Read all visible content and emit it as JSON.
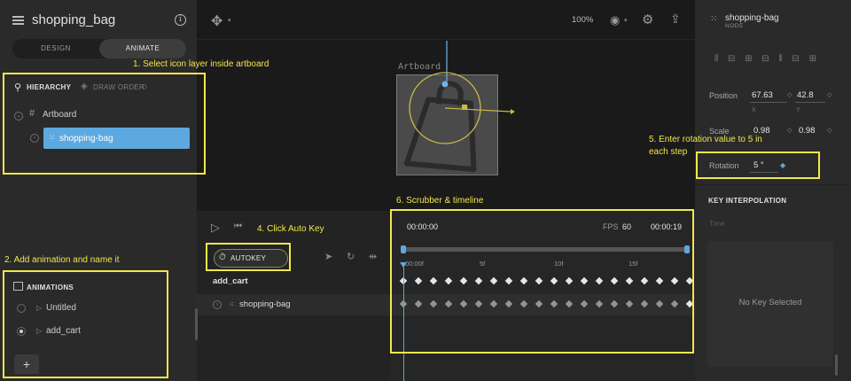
{
  "header": {
    "file_title": "shopping_bag",
    "mode_design": "DESIGN",
    "mode_animate": "ANIMATE",
    "zoom": "100%"
  },
  "hierarchy": {
    "tab_hierarchy": "HIERARCHY",
    "tab_draw_order": "DRAW ORDER",
    "artboard": "Artboard",
    "selected_node": "shopping-bag"
  },
  "animations": {
    "title": "ANIMATIONS",
    "items": [
      {
        "name": "Untitled",
        "selected": false
      },
      {
        "name": "add_cart",
        "selected": true
      }
    ],
    "add_label": "+"
  },
  "stage": {
    "artboard_label": "Artboard"
  },
  "inspector": {
    "node_name": "shopping-bag",
    "node_type": "NODE",
    "position_label": "Position",
    "position_x": "67.63",
    "position_y": "42.8",
    "x_sub": "X",
    "y_sub": "Y",
    "scale_label": "Scale",
    "scale_x": "0.98",
    "scale_y": "0.98",
    "rotation_label": "Rotation",
    "rotation_value": "5 °",
    "key_interp_title": "KEY INTERPOLATION",
    "time_label": "Time",
    "no_key": "No Key Selected"
  },
  "timeline": {
    "autokey": "AUTOKEY",
    "animation_name": "add_cart",
    "track_name": "shopping-bag",
    "current_time": "00:00:00",
    "fps_label": "FPS",
    "fps_value": "60",
    "end_time": "00:00:19",
    "frame_labels": [
      "00:00f",
      "5f",
      "10f",
      "15f"
    ]
  },
  "annotations": {
    "step1": "1. Select icon layer inside artboard",
    "step2": "2. Add animation and name it",
    "step4": "4. Click Auto Key",
    "step5_line1": "5. Enter rotation value to 5 in",
    "step5_line2": "each step",
    "step6": "6. Scrubber & timeline"
  },
  "colors": {
    "accent": "#5ea8e0",
    "annotation": "#f2e74a",
    "artboard_gizmo": "#c9b84a"
  }
}
